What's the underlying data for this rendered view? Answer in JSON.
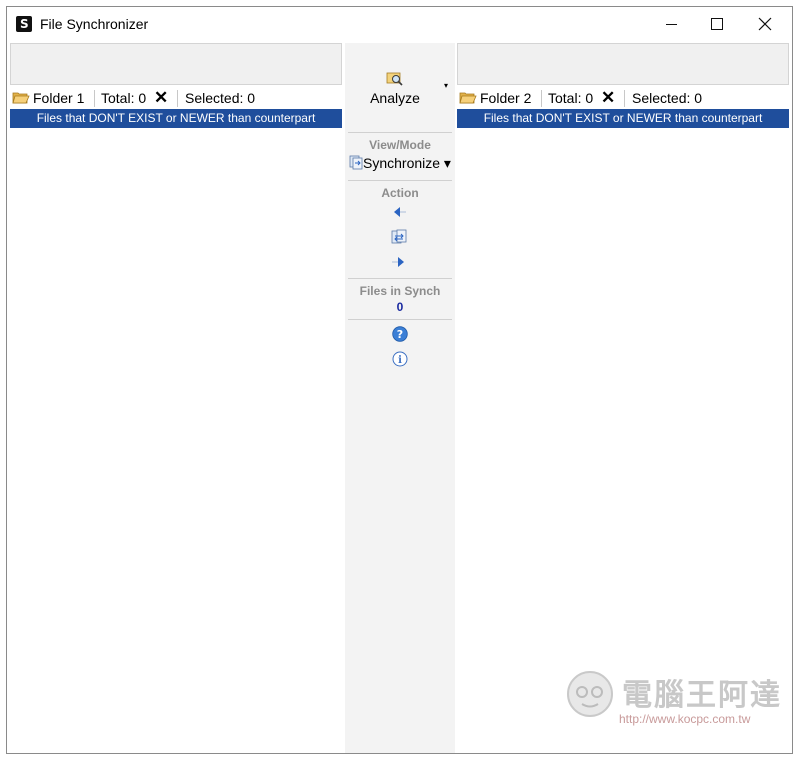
{
  "window": {
    "title": "File Synchronizer"
  },
  "left_panel": {
    "folder_label": "Folder 1",
    "total": "Total: 0",
    "clear_symbol": "✕",
    "selected": "Selected: 0",
    "filter_banner": "Files that DON'T EXIST or NEWER than counterpart"
  },
  "right_panel": {
    "folder_label": "Folder 2",
    "total": "Total: 0",
    "clear_symbol": "✕",
    "selected": "Selected: 0",
    "filter_banner": "Files that DON'T EXIST or NEWER than counterpart"
  },
  "center": {
    "analyze_label": "Analyze",
    "analyze_dropdown": "▾",
    "view_mode_label": "View/Mode",
    "view_mode_value": "Synchronize ▾",
    "action_label": "Action",
    "files_in_synch_label": "Files in Synch",
    "files_in_synch_count": "0"
  },
  "watermark": {
    "text": "電腦王阿達",
    "url": "http://www.kocpc.com.tw"
  },
  "colors": {
    "banner": "#1f4e9c",
    "count": "#1a2aa0",
    "section_label": "#8c8c8c"
  }
}
